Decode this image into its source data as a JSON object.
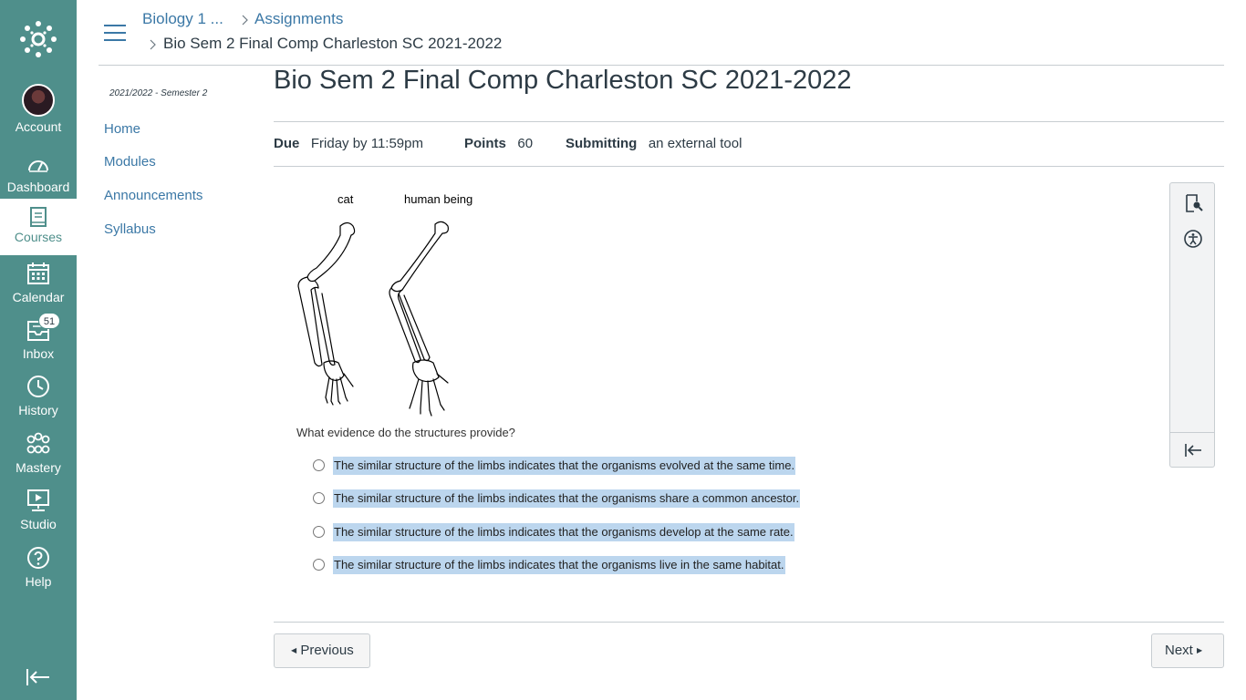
{
  "global_nav": {
    "items": [
      {
        "label": "Account"
      },
      {
        "label": "Dashboard"
      },
      {
        "label": "Courses"
      },
      {
        "label": "Calendar"
      },
      {
        "label": "Inbox",
        "badge": "51"
      },
      {
        "label": "History"
      },
      {
        "label": "Mastery"
      },
      {
        "label": "Studio"
      },
      {
        "label": "Help"
      }
    ],
    "active": "Courses"
  },
  "breadcrumb": {
    "course": "Biology 1 ...",
    "section": "Assignments",
    "current": "Bio Sem 2 Final Comp Charleston SC 2021-2022"
  },
  "course_nav": {
    "term": "2021/2022 - Semester 2",
    "items": [
      {
        "label": "Home"
      },
      {
        "label": "Modules"
      },
      {
        "label": "Announcements"
      },
      {
        "label": "Syllabus"
      }
    ]
  },
  "assignment": {
    "title": "Bio Sem 2 Final Comp Charleston SC 2021-2022",
    "due_label": "Due",
    "due_value": "Friday by 11:59pm",
    "points_label": "Points",
    "points_value": "60",
    "submitting_label": "Submitting",
    "submitting_value": "an external tool"
  },
  "question": {
    "image_labels": [
      "cat",
      "human being"
    ],
    "prompt": "What evidence do the structures provide?",
    "options": [
      "The similar structure of the limbs indicates that the organisms evolved at the same time.",
      "The similar structure of the limbs indicates that the organisms share a common ancestor.",
      "The similar structure of the limbs indicates that the organisms develop at the same rate.",
      "The similar structure of the limbs indicates that the organisms live in the same habitat."
    ]
  },
  "footer": {
    "previous_label": "Previous",
    "next_label": "Next"
  },
  "colors": {
    "nav_bg": "#4f8f8b",
    "link": "#3b78a6",
    "selection": "#bcd6ee"
  }
}
